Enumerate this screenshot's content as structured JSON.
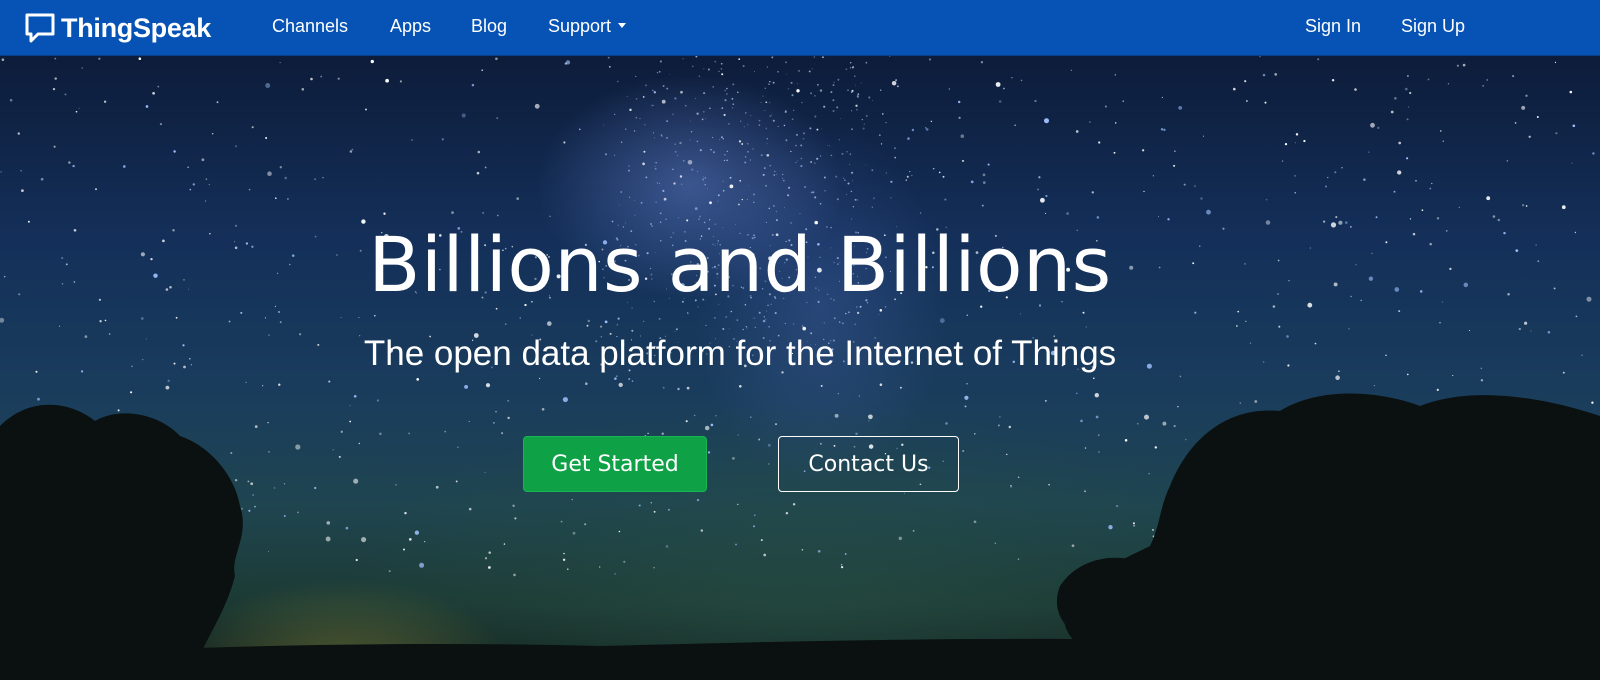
{
  "navbar": {
    "brand": "ThingSpeak",
    "brand_icon": "speech-bubble-logo-icon",
    "items": [
      {
        "label": "Channels"
      },
      {
        "label": "Apps"
      },
      {
        "label": "Blog"
      },
      {
        "label": "Support",
        "icon": "caret-down-icon"
      }
    ],
    "right_items": [
      {
        "label": "Sign In"
      },
      {
        "label": "Sign Up"
      }
    ],
    "bg_color": "#0753b5"
  },
  "hero": {
    "title": "Billions and Billions",
    "subtitle": "The open data platform for the Internet of Things",
    "primary_button": "Get Started",
    "secondary_button": "Contact Us",
    "primary_color": "#0ea145"
  }
}
